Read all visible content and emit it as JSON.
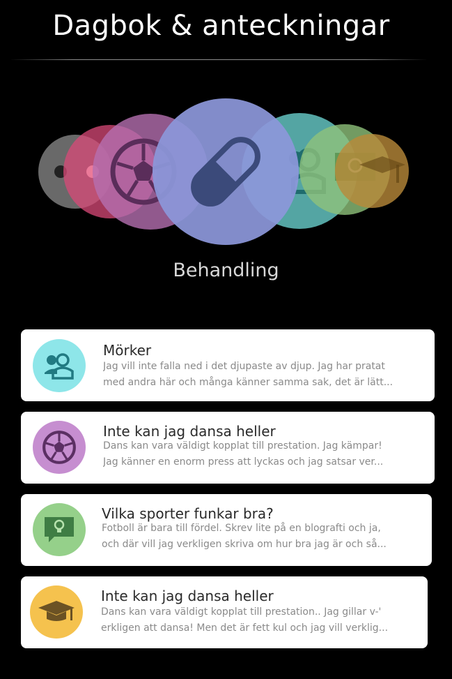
{
  "header": {
    "title": "Dagbok & anteckningar"
  },
  "categories": {
    "selected_label": "Behandling",
    "items": [
      {
        "name": "grey-dot",
        "icon": "dot-icon",
        "color": "#8a8a8a"
      },
      {
        "name": "pink",
        "icon": "dot-icon",
        "color": "#d94a78"
      },
      {
        "name": "purple",
        "icon": "soccer-ball-icon",
        "color": "#b56fb0"
      },
      {
        "name": "blue-selected",
        "icon": "pill-icon",
        "color": "#8c97d9"
      },
      {
        "name": "teal",
        "icon": "people-icon",
        "color": "#6cd3d1"
      },
      {
        "name": "green",
        "icon": "lightbulb-chat-icon",
        "color": "#8fc27a"
      },
      {
        "name": "gold",
        "icon": "graduation-cap-icon",
        "color": "#b9893a"
      }
    ]
  },
  "entries": [
    {
      "title": "Mörker",
      "line1": "Jag vill inte falla ned i det djupaste av djup. Jag har pratat",
      "line2": "med andra här och många känner samma sak, det är lätt...",
      "icon": "people-icon",
      "color": "#8ee6e9"
    },
    {
      "title": "Inte kan jag dansa heller",
      "line1": "Dans kan vara väldigt kopplat till prestation. Jag kämpar!",
      "line2": "Jag känner en enorm press att lyckas och jag satsar ver...",
      "icon": "soccer-ball-icon",
      "color": "#c68ed0"
    },
    {
      "title": "Vilka sporter funkar bra?",
      "line1": "Fotboll är bara till fördel. Skrev lite på en blografti och ja,",
      "line2": "och där vill jag verkligen skriva om hur bra jag är och så...",
      "icon": "lightbulb-chat-icon",
      "color": "#95d08a"
    },
    {
      "title": "Inte kan jag dansa heller",
      "line1": "Dans kan vara väldigt kopplat till prestation.. Jag gillar v-'",
      "line2": "erkligen att dansa! Men det är fett kul och jag vill verklig...",
      "icon": "graduation-cap-icon",
      "color": "#f5c24e"
    }
  ]
}
